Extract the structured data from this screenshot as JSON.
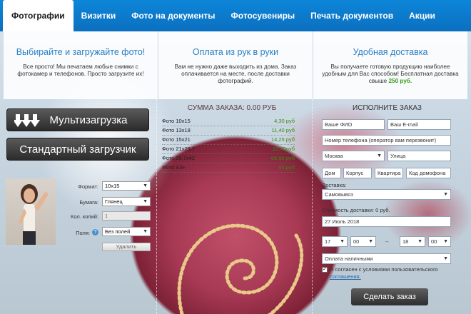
{
  "tabs": [
    {
      "label": "Фотографии",
      "active": true
    },
    {
      "label": "Визитки"
    },
    {
      "label": "Фото на документы"
    },
    {
      "label": "Фотосувениры"
    },
    {
      "label": "Печать документов"
    },
    {
      "label": "Акции"
    }
  ],
  "info": [
    {
      "title": "Выбирайте и загружайте фото!",
      "text": "Все просто! Мы печатаем любые снимки с фотокамер и телефонов. Просто загрузите их!"
    },
    {
      "title": "Оплата из рук в руки",
      "text": "Вам не нужно даже выходить из дома. Заказ оплачивается на месте, после доставки фотографий."
    },
    {
      "title": "Удобная доставка",
      "text": "Вы получаете готовую продукцию наиболее удобным для Вас способом! Бесплатная доставка свыше",
      "highlight": "250 руб."
    }
  ],
  "upload": {
    "multi_label": "Мультизагрузка",
    "standard_label": "Стандартный загрузчик"
  },
  "photo_form": {
    "format_label": "Формат:",
    "format_value": "10x15",
    "paper_label": "Бумага:",
    "paper_value": "Глянец",
    "copies_label": "Кол. копий:",
    "copies_value": "1",
    "margins_label": "Поля:",
    "margins_value": "Без полей",
    "delete_label": "Удалить"
  },
  "summary": {
    "title": "СУММА ЗАКАЗА: 0.00 РУБ",
    "prices": [
      {
        "name": "Фото 10x15",
        "price": "4,30 руб"
      },
      {
        "name": "Фото 13x18",
        "price": "11,40 руб"
      },
      {
        "name": "Фото 15x21",
        "price": "14,25 руб"
      },
      {
        "name": "Фото 21x29,7",
        "price": "23,75руб"
      },
      {
        "name": "Фото 29,7x42",
        "price": "66,50 руб"
      },
      {
        "name": "Фото А3+",
        "price": "95 руб"
      }
    ]
  },
  "order": {
    "title": "ИСПОЛНИТЕ ЗАКАЗ",
    "name_placeholder": "Ваше ФИО",
    "email_placeholder": "Ваш E-mail",
    "phone_placeholder": "Номер телефона (оператор вам перезвонит)",
    "city_value": "Москва",
    "street_placeholder": "Улица",
    "house_placeholder": "Дом",
    "corpus_placeholder": "Корпус",
    "flat_placeholder": "Квартира",
    "intercom_placeholder": "Код домофона",
    "delivery_label": "Доставка:",
    "delivery_value": "Самовывоз",
    "cost_label": "Стоимость доставки: 0 руб.",
    "date_value": "27 Июль 2018",
    "time_from_h": "17",
    "time_from_m": "00",
    "time_sep": "→",
    "time_to_h": "18",
    "time_to_m": "00",
    "payment_value": "Оплата наличными",
    "agree_text": "Я согласен с условиями пользовательского",
    "agree_link": "соглашения.",
    "submit_label": "Сделать заказ"
  },
  "colors": {
    "accent": "#0b76cc",
    "price_green": "#3a8a10",
    "title_blue": "#2b7fc4"
  }
}
